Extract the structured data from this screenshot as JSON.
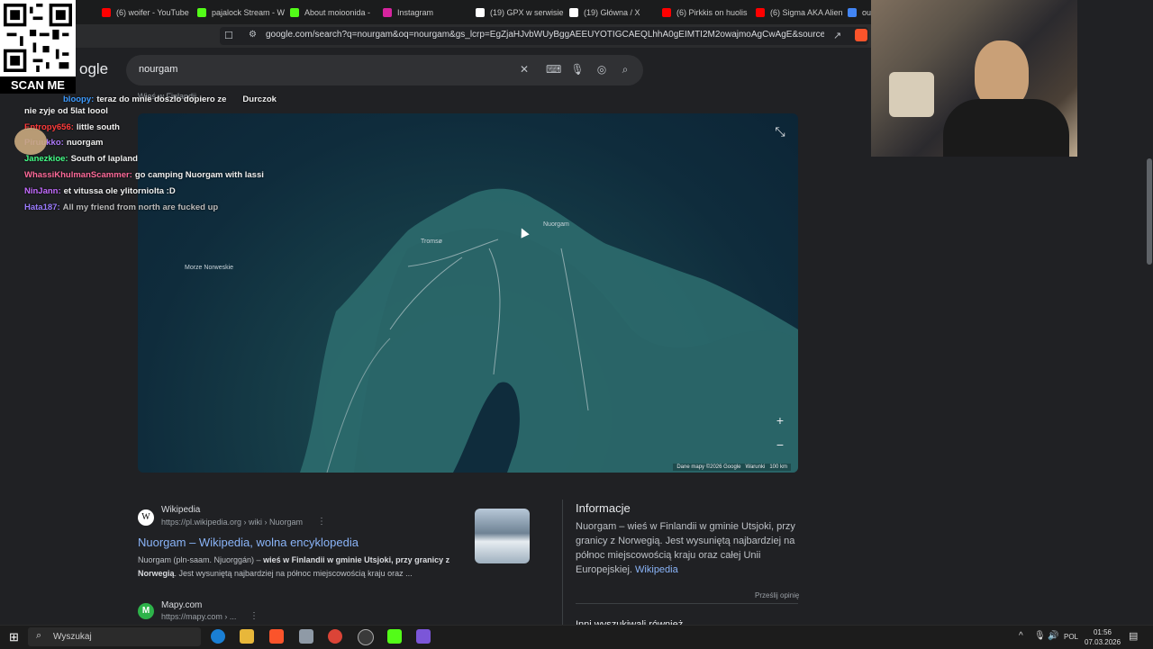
{
  "tabs": [
    {
      "label": "(6) woifer - YouTube",
      "color": "#ff0000"
    },
    {
      "label": "pajalock Stream - W",
      "color": "#53fc18"
    },
    {
      "label": "About moioonida -",
      "color": "#53fc18"
    },
    {
      "label": "Instagram",
      "color": "#d6249f"
    },
    {
      "label": "(19) GPX w serwisie",
      "color": "#ffffff"
    },
    {
      "label": "(19) Główna / X",
      "color": "#ffffff"
    },
    {
      "label": "(6) Pirkkis on huolis",
      "color": "#ff0000"
    },
    {
      "label": "(6) Sigma AKA Alien",
      "color": "#ff0000"
    },
    {
      "label": "ou",
      "color": "#4285f4"
    }
  ],
  "browser": {
    "url": "google.com/search?q=nourgam&oq=nourgam&gs_lcrp=EgZjaHJvbWUyBggAEEUYOTIGCAEQLhhA0gEIMTI2M2owajmoAgCwAgE&sourceid=chrome..."
  },
  "overlay": {
    "qr_caption": "SCAN ME"
  },
  "google": {
    "logo_fragment": "ogle",
    "query": "nourgam",
    "subtitle_fragment": "Wieś w Finlandii"
  },
  "chat": [
    {
      "user": "bloopy:",
      "text": "teraz do mnie doszlo dopiero ze",
      "extra": "Durczok",
      "color": "#3d9bff"
    },
    {
      "user": "",
      "text": "nie zyje od 5lat loool",
      "color": "#ffffff"
    },
    {
      "user": "Entropy656:",
      "text": "little south",
      "color": "#ff3b3b"
    },
    {
      "user": "Piruukko:",
      "text": "nuorgam",
      "color": "#b07bff"
    },
    {
      "user": "Janezkioe:",
      "text": "South of lapland",
      "color": "#44ff88"
    },
    {
      "user": "WhassiKhulmanScammer:",
      "text": "go camping Nuorgam with lassi",
      "color": "#ff6a9a"
    },
    {
      "user": "NinJann:",
      "text": "et vitussa ole ylitorniolta :D",
      "color": "#c46bff"
    },
    {
      "user": "Hata187:",
      "text": "All my friend from north are fucked up",
      "color": "#9b7cff"
    }
  ],
  "map": {
    "labels": {
      "sea": "Morze Norweskie",
      "tromso": "Tromsø",
      "nuorgam": "Nuorgam"
    },
    "attribution": "Dane mapy ©2026 Google",
    "terms": "Warunki",
    "scale": "100 km"
  },
  "results": [
    {
      "site": "Wikipedia",
      "url": "https://pl.wikipedia.org › wiki › Nuorgam",
      "title": "Nuorgam – Wikipedia, wolna encyklopedia",
      "snippet_start": "Nuorgam (pln-saam. Njuorggán) – ",
      "snippet_bold": "wieś w Finlandii w gminie Utsjoki, przy granicy z Norwegią",
      "snippet_end": ". Jest wysuniętą najbardziej na północ miejscowością kraju oraz ..."
    },
    {
      "site": "Mapy.com",
      "url": "https://mapy.com › ..."
    }
  ],
  "knowledge": {
    "title": "Informacje",
    "text": "Nuorgam – wieś w Finlandii w gminie Utsjoki, przy granicy z Norwegią. Jest wysuniętą najbardziej na północ miejscowością kraju oraz całej Unii Europejskiej.",
    "link": "Wikipedia",
    "feedback": "Prześlij opinię",
    "more_fragment": "Inni wyszukiwali również"
  },
  "taskbar": {
    "search_placeholder": "Wyszukaj",
    "lang": "POL",
    "time": "01:56",
    "date": "07.03.2026"
  }
}
